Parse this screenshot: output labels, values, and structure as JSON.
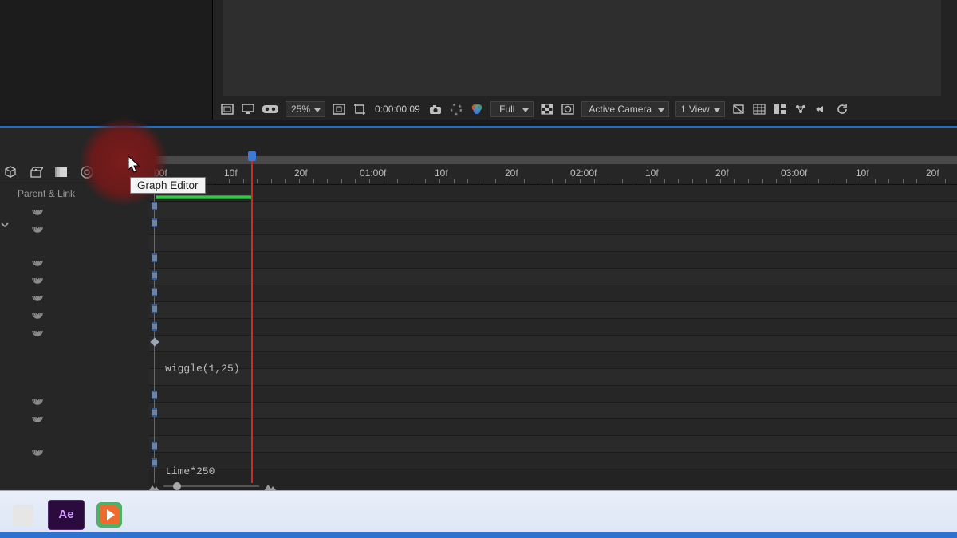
{
  "viewer": {
    "zoom": "25%",
    "timecode": "0:00:00:09",
    "resolution": "Full",
    "camera": "Active Camera",
    "views": "1 View"
  },
  "timeline": {
    "column_header": "Parent & Link",
    "tooltip": "Graph Editor",
    "ruler_ticks": [
      "00f",
      "10f",
      "20f",
      "01:00f",
      "10f",
      "20f",
      "02:00f",
      "10f",
      "20f",
      "03:00f",
      "10f",
      "20f"
    ],
    "expressions": {
      "wiggle": "wiggle(1,25)",
      "time": "time*250"
    }
  },
  "icons": {
    "grid": "grid-icon",
    "monitor": "monitor-icon",
    "vr": "vr-goggles-icon",
    "region": "region-icon",
    "crop": "crop-icon",
    "snapshot": "camera-icon",
    "color": "color-management-icon",
    "clover": "channel-icon",
    "transparency": "transparency-grid-icon",
    "mask": "mask-icon",
    "reset": "reset-exposure-icon",
    "guides": "guides-icon",
    "tile": "tile-icon",
    "pixel": "pixel-aspect-icon",
    "fast": "fast-previews-icon",
    "threeD": "3d-renderer-icon",
    "gift": "draft-3d-icon",
    "stacks": "motion-blur-icon",
    "blend": "frame-blending-icon",
    "graph": "graph-editor-icon",
    "spiral": "expression-pickwhip-icon",
    "refresh": "refresh-icon"
  },
  "colors": {
    "accent_blue": "#1c6dd0",
    "playhead": "#cc2b2b",
    "layer_bar": "#2ecc40",
    "ae": "#2b0b3d"
  },
  "taskbar": {
    "apps": [
      "After Effects",
      "Camtasia"
    ]
  }
}
